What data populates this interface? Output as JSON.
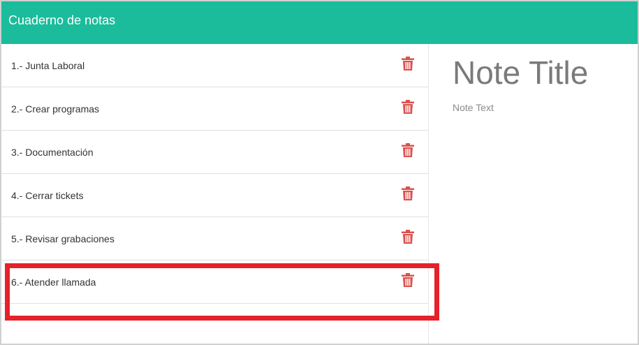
{
  "header": {
    "title": "Cuaderno de notas"
  },
  "notes": [
    {
      "label": "1.- Junta Laboral",
      "delete_icon": "trash-icon"
    },
    {
      "label": "2.- Crear programas",
      "delete_icon": "trash-icon"
    },
    {
      "label": "3.- Documentación",
      "delete_icon": "trash-icon"
    },
    {
      "label": "4.- Cerrar tickets",
      "delete_icon": "trash-icon"
    },
    {
      "label": "5.- Revisar grabaciones",
      "delete_icon": "trash-icon"
    },
    {
      "label": "6.- Atender llamada",
      "delete_icon": "trash-icon"
    }
  ],
  "highlighted_note": 6,
  "note_view": {
    "title_placeholder": "Note Title",
    "text_placeholder": "Note Text"
  },
  "colors": {
    "header_bg": "#1bbc9b",
    "delete_icon": "#d9534f",
    "highlight_box": "#e5212a"
  }
}
